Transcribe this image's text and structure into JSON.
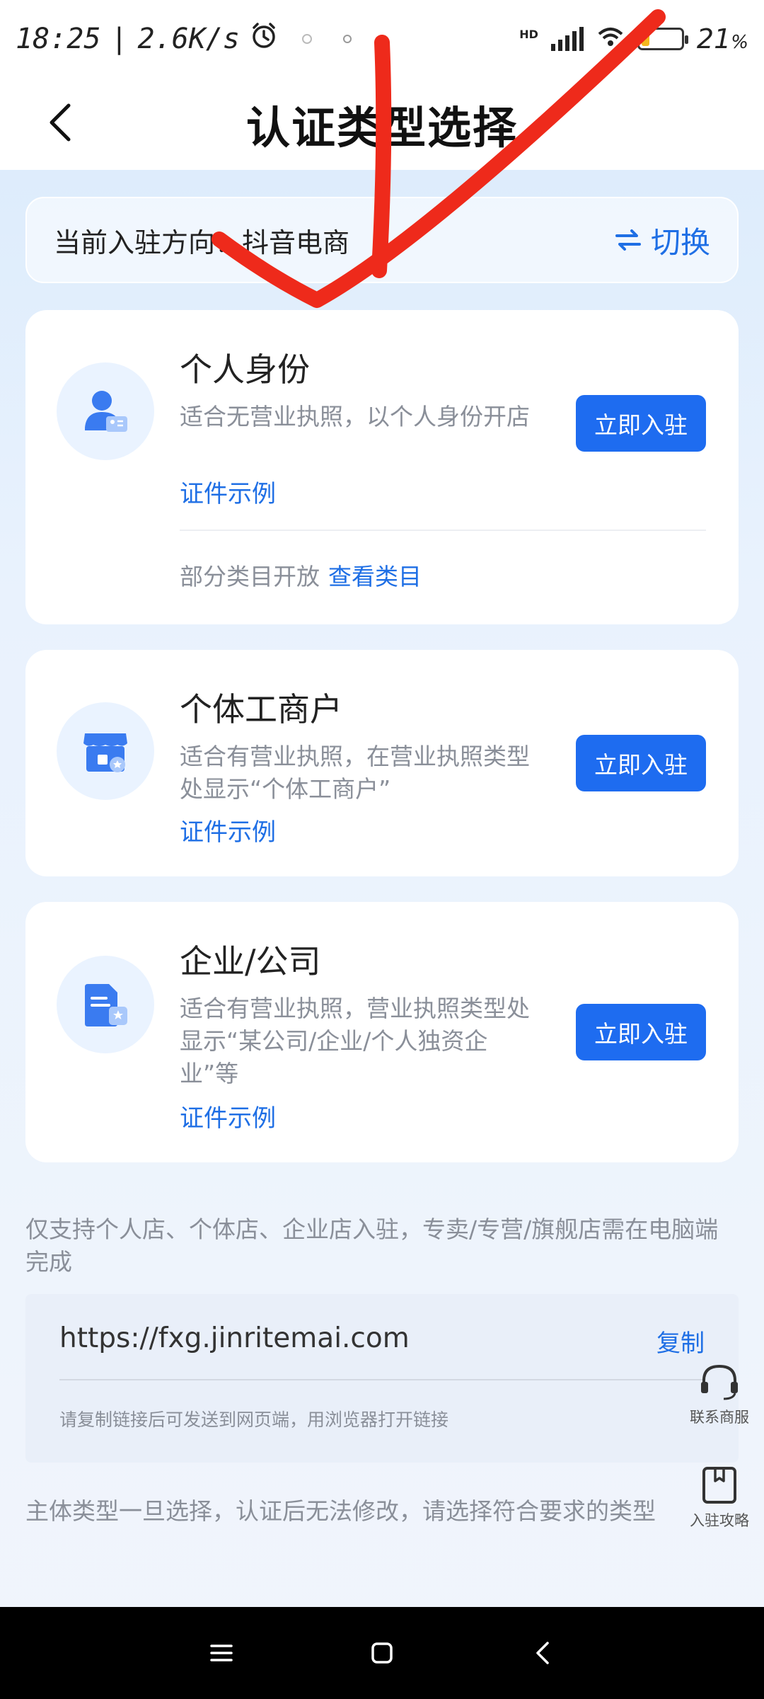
{
  "status_bar": {
    "time": "18:25",
    "separator": "|",
    "speed": "2.6K/s",
    "battery": "21",
    "battery_unit": "%",
    "battery_level": 0.21,
    "network_badge": "HD"
  },
  "header": {
    "title": "认证类型选择",
    "back_icon": "chevron-left-icon"
  },
  "direction": {
    "label": "当前入驻方向：抖音电商",
    "switch_label": "切换",
    "switch_icon": "swap-arrows-icon"
  },
  "cards": [
    {
      "icon": "person-id-icon",
      "title": "个人身份",
      "desc": "适合无营业执照，以个人身份开店",
      "example": "证件示例",
      "button": "立即入驻",
      "category_text": "部分类目开放",
      "category_link": "查看类目"
    },
    {
      "icon": "shop-icon",
      "title": "个体工商户",
      "desc": "适合有营业执照，在营业执照类型处显示“个体工商户”",
      "example": "证件示例",
      "button": "立即入驻"
    },
    {
      "icon": "company-document-icon",
      "title": "企业/公司",
      "desc": "适合有营业执照，营业执照类型处显示“某公司/企业/个人独资企业”等",
      "example": "证件示例",
      "button": "立即入驻"
    }
  ],
  "notice_top": "仅支持个人店、个体店、企业店入驻，专卖/专营/旗舰店需在电脑端完成",
  "url_box": {
    "url": "https://fxg.jinritemai.com",
    "copy_label": "复制",
    "hint": "请复制链接后可发送到网页端，用浏览器打开链接"
  },
  "notice_bottom": "主体类型一旦选择，认证后无法修改，请选择符合要求的类型",
  "floating": {
    "service_label": "联系商服",
    "guide_label": "入驻攻略"
  },
  "colors": {
    "accent": "#1e6cf0",
    "link": "#1f6fe5",
    "annotation": "#ee2a1b"
  }
}
